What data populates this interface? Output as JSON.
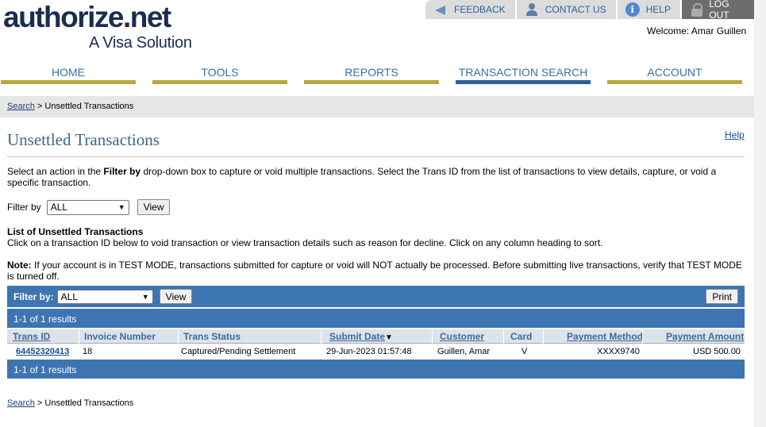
{
  "brand": {
    "name_main": "authorize",
    "name_dot": ".",
    "name_tld": "net",
    "tagline": "A Visa Solution"
  },
  "util": {
    "feedback": "FEEDBACK",
    "contact": "CONTACT US",
    "help": "HELP",
    "logout": "LOG OUT",
    "help_glyph": "i"
  },
  "welcome": "Welcome: Amar Guillen",
  "nav": {
    "home": "HOME",
    "tools": "TOOLS",
    "reports": "REPORTS",
    "transaction_search": "TRANSACTION SEARCH",
    "account": "ACCOUNT"
  },
  "breadcrumb": {
    "link": "Search",
    "sep": " > ",
    "current": "Unsettled Transactions"
  },
  "page": {
    "title": "Unsettled Transactions",
    "help": "Help",
    "intro_a": "Select an action in the ",
    "intro_bold": "Filter by",
    "intro_b": " drop-down box to capture or void multiple transactions. Select the Trans ID from the list of transactions to view details, capture, or void a specific transaction.",
    "filter_label": "Filter by",
    "filter_value": "ALL",
    "view_button": "View",
    "list_heading": "List of Unsettled Transactions",
    "list_desc": "Click on a transaction ID below to void transaction or view transaction details such as reason for decline. Click on any column heading to sort.",
    "note_bold": "Note:",
    "note_text": " If your account is in TEST MODE, transactions submitted for capture or void will NOT actually be processed. Before submitting live transactions, verify that TEST MODE is turned off."
  },
  "table": {
    "filter_label": "Filter by:",
    "filter_value": "ALL",
    "view_button": "View",
    "print_button": "Print",
    "results_top": "1-1 of 1 results",
    "results_bottom": "1-1 of 1 results",
    "columns": {
      "trans_id": "Trans ID",
      "invoice": "Invoice Number",
      "status": "Trans Status",
      "submit_date": "Submit Date",
      "customer": "Customer",
      "card": "Card",
      "payment_method": "Payment Method",
      "payment_amount": "Payment Amount"
    },
    "rows": [
      {
        "trans_id": "64452320413",
        "invoice": "18",
        "status": "Captured/Pending Settlement",
        "submit_date": "29-Jun-2023 01:57:48",
        "customer": "Guillen, Amar",
        "card": "V",
        "payment_method": "XXXX9740",
        "payment_amount": "USD 500.00"
      }
    ]
  },
  "colors": {
    "nav_gold": "#b5a93a",
    "nav_active": "#2d5f9a",
    "table_blue": "#3d75b3",
    "title_blue": "#3a6690"
  }
}
